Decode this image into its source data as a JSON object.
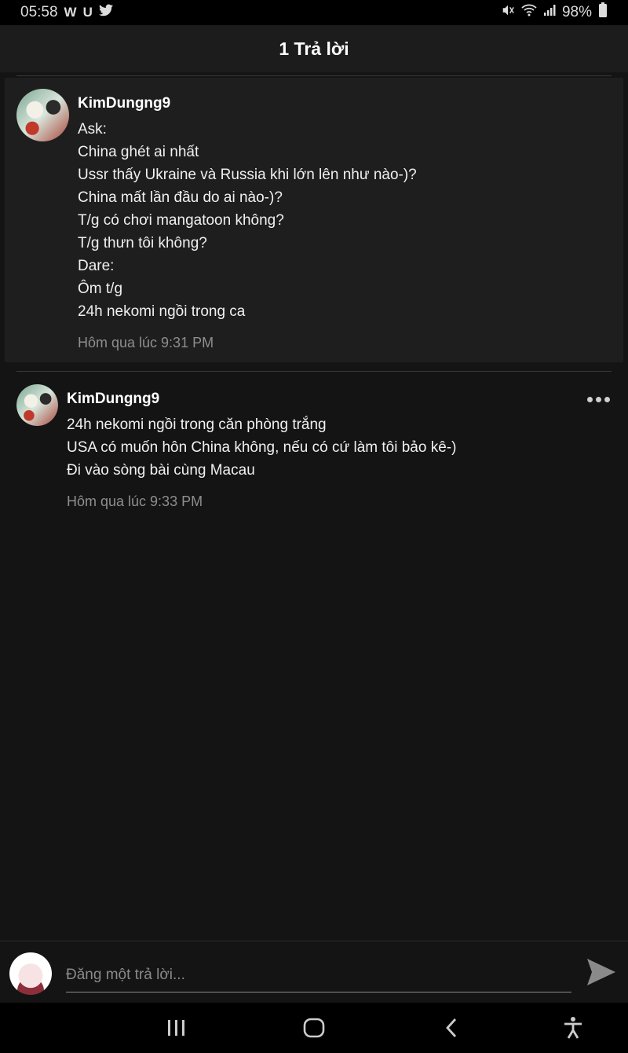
{
  "status_bar": {
    "time": "05:58",
    "app_icons": [
      "w-icon",
      "u-icon",
      "twitter-icon"
    ],
    "battery": "98%"
  },
  "header": {
    "title": "1 Trả lời"
  },
  "parent_comment": {
    "username": "KimDungng9",
    "lines": [
      "Ask:",
      "China ghét ai nhất",
      "Ussr thấy Ukraine và Russia khi lớn lên như nào-)?",
      "China mất lần đầu do ai nào-)?",
      "T/g có chơi mangatoon không?",
      "T/g thưn tôi không?",
      "Dare:",
      "Ôm t/g",
      "24h nekomi ngồi trong ca"
    ],
    "timestamp": "Hôm qua lúc 9:31 PM"
  },
  "reply": {
    "username": "KimDungng9",
    "lines": [
      "24h nekomi ngồi trong căn phòng trắng",
      "USA có muốn hôn China không, nếu có cứ làm tôi bảo kê-)",
      "Đi vào sòng bài cùng Macau"
    ],
    "timestamp": "Hôm qua lúc 9:33 PM"
  },
  "composer": {
    "placeholder": "Đăng một trả lời..."
  },
  "colors": {
    "background": "#141414",
    "card": "#1e1e1e",
    "muted": "#8e8e8e"
  }
}
